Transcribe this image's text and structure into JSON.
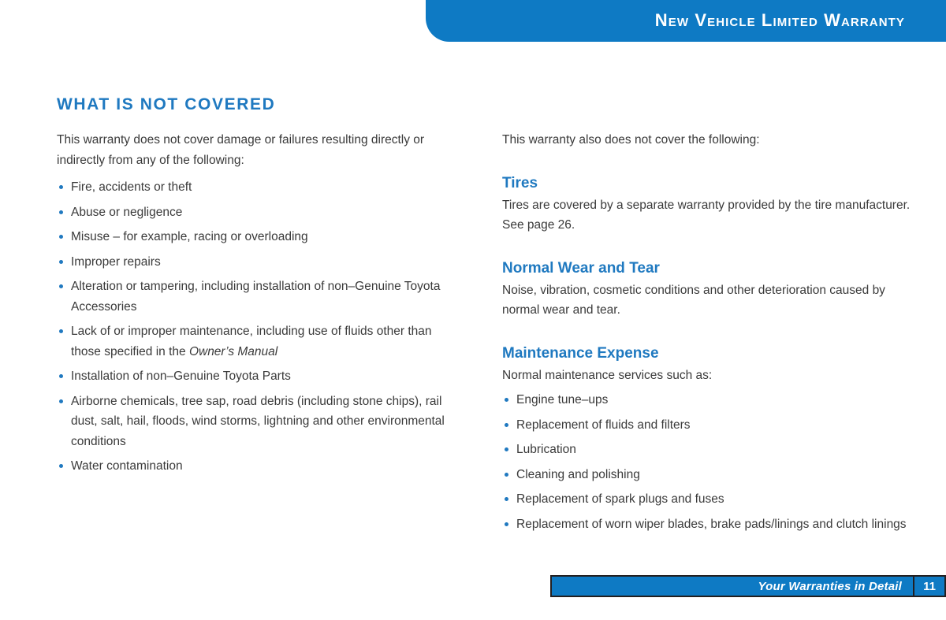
{
  "header": {
    "title": "New Vehicle Limited Warranty",
    "background_color": "#0e7ac4"
  },
  "accent_color": "#1f79c0",
  "body_text_color": "#3a3a3a",
  "section": {
    "title": "WHAT IS NOT COVERED"
  },
  "left_column": {
    "intro": "This warranty does not cover damage or failures resulting directly or indirectly from any of the following:",
    "items": [
      "Fire, accidents or theft",
      "Abuse or negligence",
      "Misuse – for example, racing or overloading",
      "Improper repairs",
      "Alteration or tampering, including installation of non–Genuine Toyota Accessories",
      "Installation of non–Genuine Toyota Parts",
      "Airborne chemicals, tree sap, road debris (including stone chips), rail dust, salt, hail, floods, wind storms, lightning and other environmental conditions",
      "Water contamination"
    ],
    "maintenance_item": {
      "prefix": "Lack of or improper maintenance, including use of fluids other than those specified in the ",
      "italic": "Owner’s Manual",
      "suffix": ""
    }
  },
  "right_column": {
    "intro": "This warranty also does not cover the following:",
    "sections": [
      {
        "heading": "Tires",
        "body": "Tires are covered by a separate warranty provided by the tire manufacturer. See page 26.",
        "items": []
      },
      {
        "heading": "Normal Wear and Tear",
        "body": "Noise, vibration, cosmetic conditions and other deterioration caused by normal wear and tear.",
        "items": []
      },
      {
        "heading": "Maintenance Expense",
        "body": "Normal maintenance services such as:",
        "items": [
          "Engine tune–ups",
          "Replacement of fluids and filters",
          "Lubrication",
          "Cleaning and polishing",
          "Replacement of spark plugs and fuses",
          "Replacement of worn wiper blades, brake pads/linings and clutch linings"
        ]
      }
    ]
  },
  "footer": {
    "label": "Your Warranties in Detail",
    "page_number": "11"
  }
}
